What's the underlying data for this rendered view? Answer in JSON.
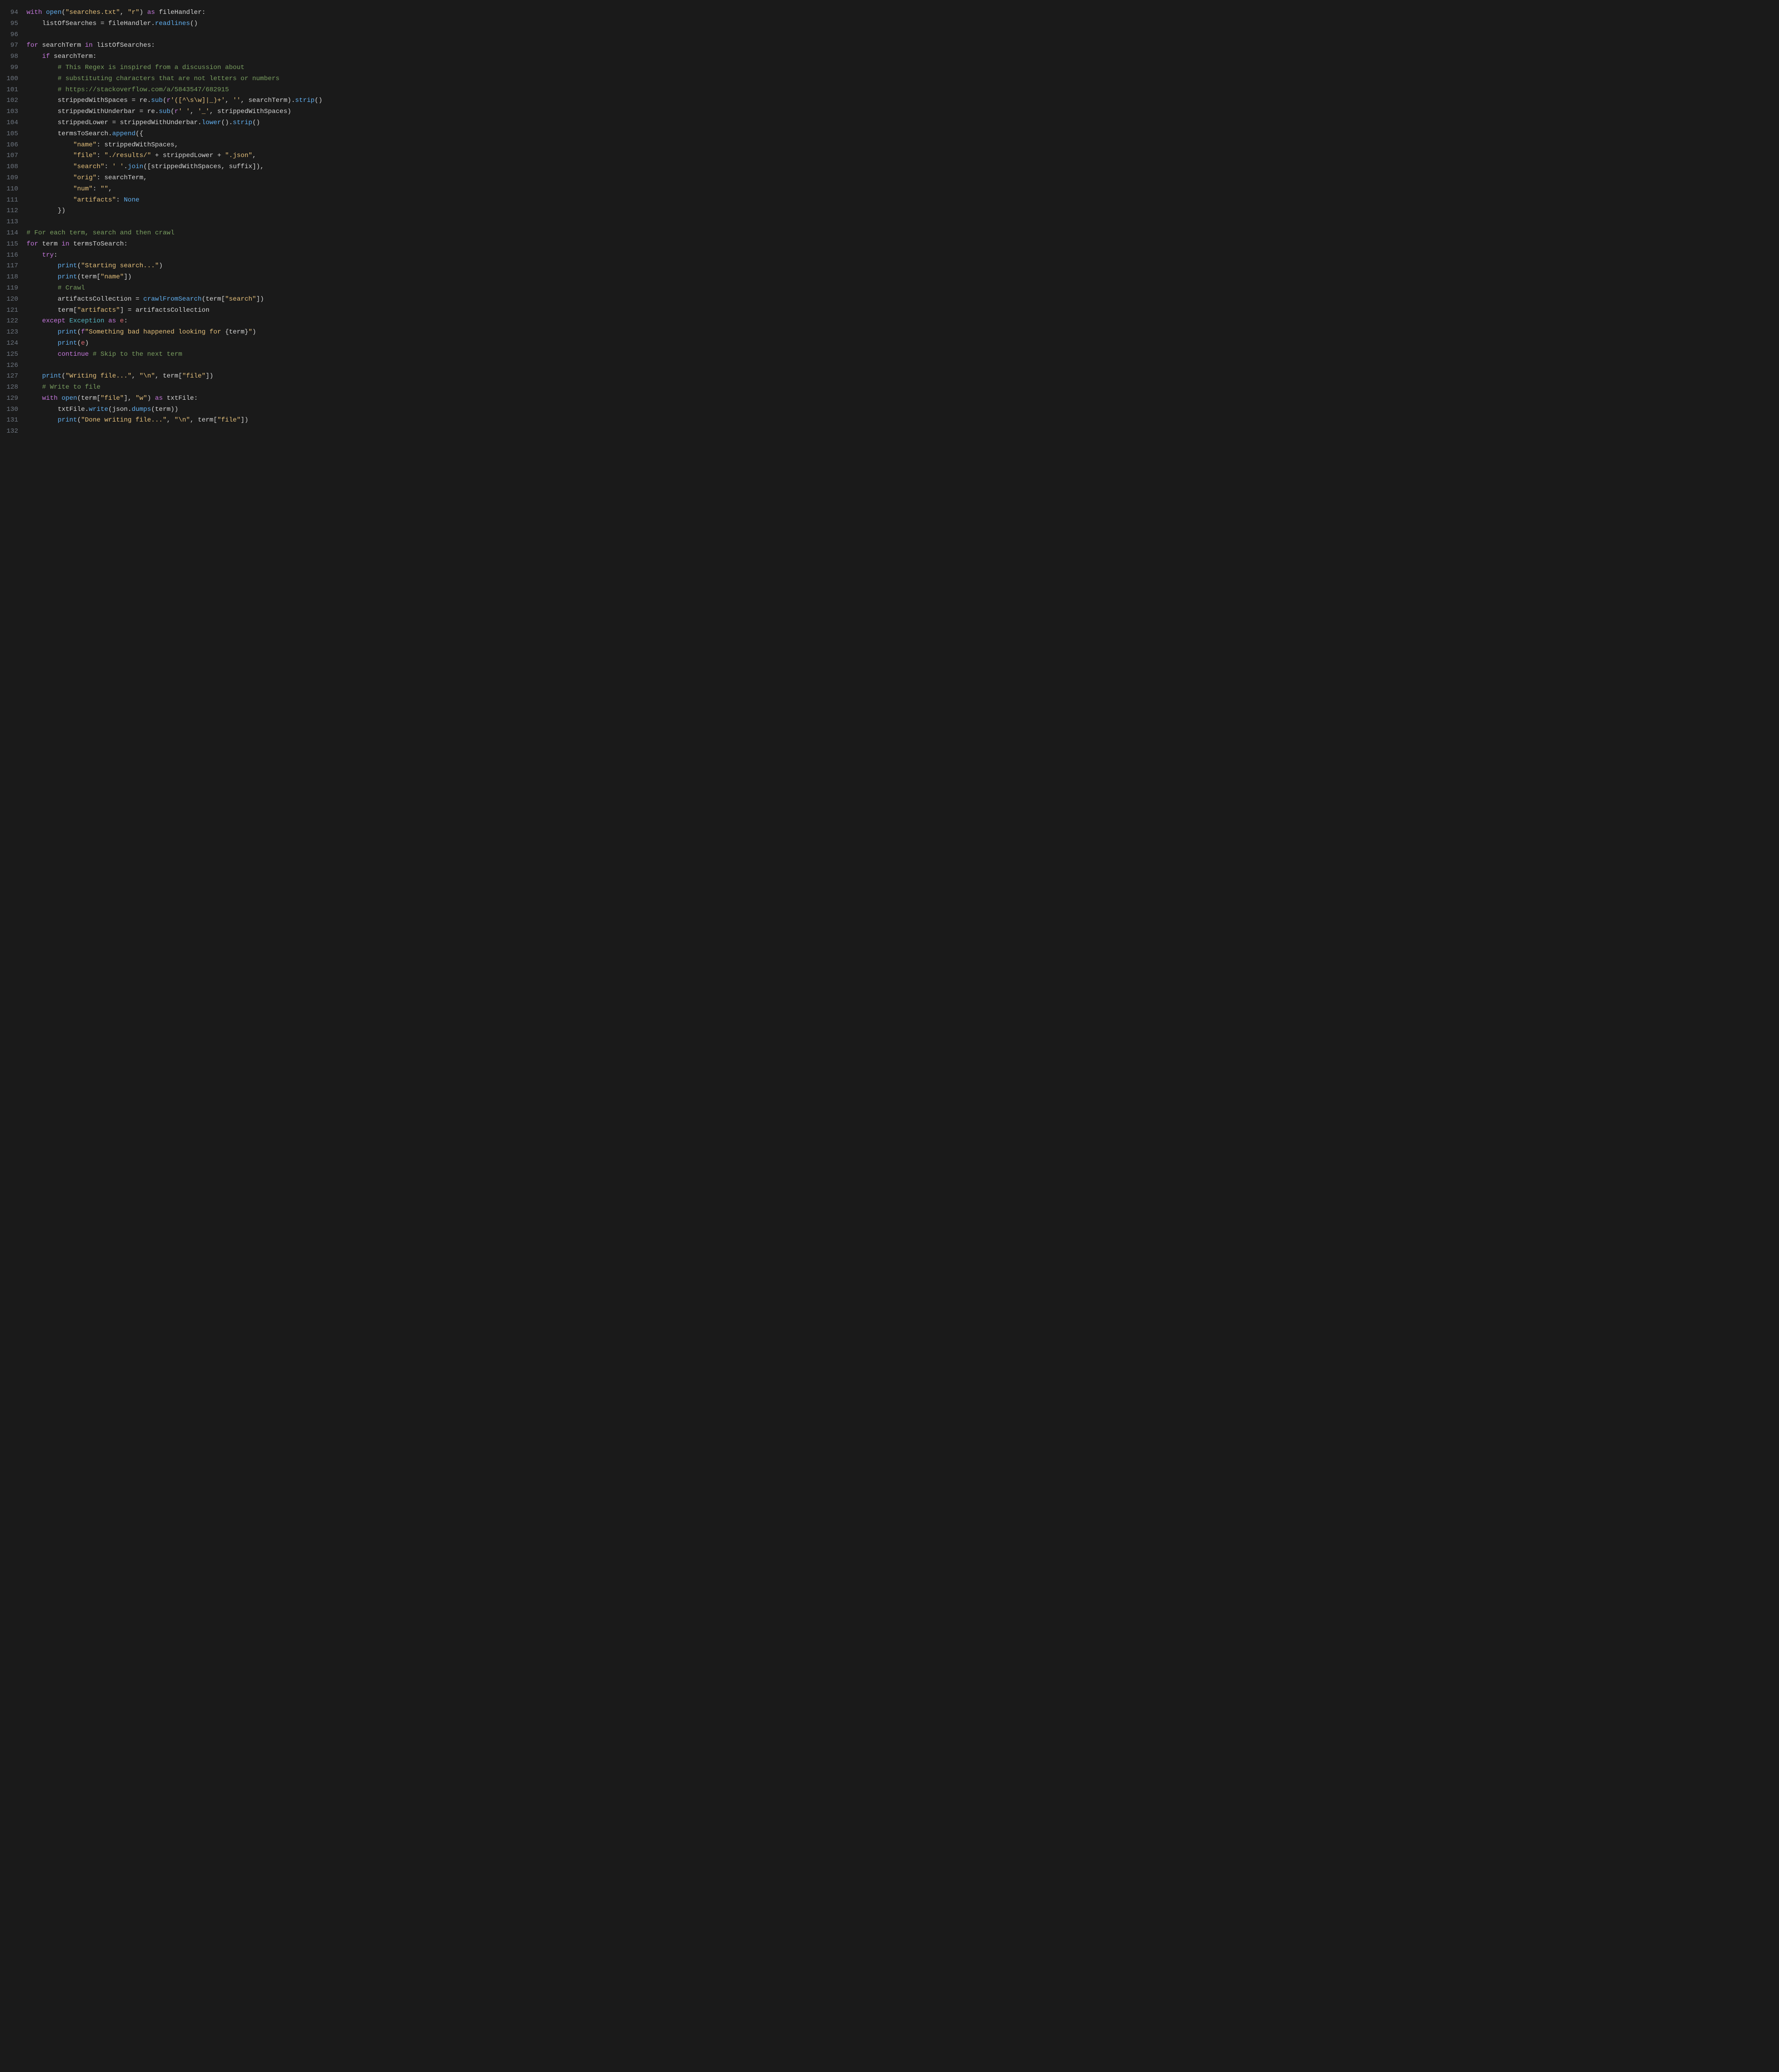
{
  "editor": {
    "startLine": 94,
    "lines": [
      {
        "n": 94,
        "tokens": [
          [
            "kw",
            "with"
          ],
          [
            "sp",
            " "
          ],
          [
            "fn",
            "open"
          ],
          [
            "op",
            "("
          ],
          [
            "str",
            "\"searches.txt\""
          ],
          [
            "op",
            ", "
          ],
          [
            "str",
            "\"r\""
          ],
          [
            "op",
            ") "
          ],
          [
            "kw",
            "as"
          ],
          [
            "sp",
            " "
          ],
          [
            "id",
            "fileHandler"
          ],
          [
            "op",
            ":"
          ]
        ]
      },
      {
        "n": 95,
        "tokens": [
          [
            "sp",
            "    "
          ],
          [
            "id",
            "listOfSearches"
          ],
          [
            "op",
            " = "
          ],
          [
            "id",
            "fileHandler"
          ],
          [
            "op",
            "."
          ],
          [
            "fn",
            "readlines"
          ],
          [
            "op",
            "()"
          ]
        ]
      },
      {
        "n": 96,
        "tokens": []
      },
      {
        "n": 97,
        "tokens": [
          [
            "kw",
            "for"
          ],
          [
            "sp",
            " "
          ],
          [
            "id",
            "searchTerm"
          ],
          [
            "sp",
            " "
          ],
          [
            "kw",
            "in"
          ],
          [
            "sp",
            " "
          ],
          [
            "id",
            "listOfSearches"
          ],
          [
            "op",
            ":"
          ]
        ]
      },
      {
        "n": 98,
        "tokens": [
          [
            "sp",
            "    "
          ],
          [
            "kw",
            "if"
          ],
          [
            "sp",
            " "
          ],
          [
            "id",
            "searchTerm"
          ],
          [
            "op",
            ":"
          ]
        ]
      },
      {
        "n": 99,
        "tokens": [
          [
            "sp",
            "        "
          ],
          [
            "comment",
            "# This Regex is inspired from a discussion about"
          ]
        ]
      },
      {
        "n": 100,
        "tokens": [
          [
            "sp",
            "        "
          ],
          [
            "comment",
            "# substituting characters that are not letters or numbers"
          ]
        ]
      },
      {
        "n": 101,
        "tokens": [
          [
            "sp",
            "        "
          ],
          [
            "comment",
            "# https://stackoverflow.com/a/5843547/682915"
          ]
        ]
      },
      {
        "n": 102,
        "tokens": [
          [
            "sp",
            "        "
          ],
          [
            "id",
            "strippedWithSpaces"
          ],
          [
            "op",
            " = "
          ],
          [
            "id",
            "re"
          ],
          [
            "op",
            "."
          ],
          [
            "fn",
            "sub"
          ],
          [
            "op",
            "("
          ],
          [
            "strprefix",
            "r"
          ],
          [
            "str",
            "'([^\\s\\w]|_)+'"
          ],
          [
            "op",
            ", "
          ],
          [
            "str",
            "''"
          ],
          [
            "op",
            ", "
          ],
          [
            "id",
            "searchTerm"
          ],
          [
            "op",
            ")."
          ],
          [
            "fn",
            "strip"
          ],
          [
            "op",
            "()"
          ]
        ]
      },
      {
        "n": 103,
        "tokens": [
          [
            "sp",
            "        "
          ],
          [
            "id",
            "strippedWithUnderbar"
          ],
          [
            "op",
            " = "
          ],
          [
            "id",
            "re"
          ],
          [
            "op",
            "."
          ],
          [
            "fn",
            "sub"
          ],
          [
            "op",
            "("
          ],
          [
            "strprefix",
            "r"
          ],
          [
            "str",
            "' '"
          ],
          [
            "op",
            ", "
          ],
          [
            "str",
            "'_'"
          ],
          [
            "op",
            ", "
          ],
          [
            "id",
            "strippedWithSpaces"
          ],
          [
            "op",
            ")"
          ]
        ]
      },
      {
        "n": 104,
        "tokens": [
          [
            "sp",
            "        "
          ],
          [
            "id",
            "strippedLower"
          ],
          [
            "op",
            " = "
          ],
          [
            "id",
            "strippedWithUnderbar"
          ],
          [
            "op",
            "."
          ],
          [
            "fn",
            "lower"
          ],
          [
            "op",
            "()."
          ],
          [
            "fn",
            "strip"
          ],
          [
            "op",
            "()"
          ]
        ]
      },
      {
        "n": 105,
        "tokens": [
          [
            "sp",
            "        "
          ],
          [
            "id",
            "termsToSearch"
          ],
          [
            "op",
            "."
          ],
          [
            "fn",
            "append"
          ],
          [
            "op",
            "({"
          ]
        ]
      },
      {
        "n": 106,
        "tokens": [
          [
            "sp",
            "            "
          ],
          [
            "str",
            "\"name\""
          ],
          [
            "op",
            ": "
          ],
          [
            "id",
            "strippedWithSpaces"
          ],
          [
            "op",
            ","
          ]
        ]
      },
      {
        "n": 107,
        "tokens": [
          [
            "sp",
            "            "
          ],
          [
            "str",
            "\"file\""
          ],
          [
            "op",
            ": "
          ],
          [
            "str",
            "\"./results/\""
          ],
          [
            "op",
            " + "
          ],
          [
            "id",
            "strippedLower"
          ],
          [
            "op",
            " + "
          ],
          [
            "str",
            "\".json\""
          ],
          [
            "op",
            ","
          ]
        ]
      },
      {
        "n": 108,
        "tokens": [
          [
            "sp",
            "            "
          ],
          [
            "str",
            "\"search\""
          ],
          [
            "op",
            ": "
          ],
          [
            "str",
            "' '"
          ],
          [
            "op",
            "."
          ],
          [
            "fn",
            "join"
          ],
          [
            "op",
            "(["
          ],
          [
            "id",
            "strippedWithSpaces"
          ],
          [
            "op",
            ", "
          ],
          [
            "id",
            "suffix"
          ],
          [
            "op",
            "]),"
          ]
        ]
      },
      {
        "n": 109,
        "tokens": [
          [
            "sp",
            "            "
          ],
          [
            "str",
            "\"orig\""
          ],
          [
            "op",
            ": "
          ],
          [
            "id",
            "searchTerm"
          ],
          [
            "op",
            ","
          ]
        ]
      },
      {
        "n": 110,
        "tokens": [
          [
            "sp",
            "            "
          ],
          [
            "str",
            "\"num\""
          ],
          [
            "op",
            ": "
          ],
          [
            "str",
            "\"\""
          ],
          [
            "op",
            ","
          ]
        ]
      },
      {
        "n": 111,
        "tokens": [
          [
            "sp",
            "            "
          ],
          [
            "str",
            "\"artifacts\""
          ],
          [
            "op",
            ": "
          ],
          [
            "const",
            "None"
          ]
        ]
      },
      {
        "n": 112,
        "tokens": [
          [
            "sp",
            "        "
          ],
          [
            "op",
            "})"
          ]
        ]
      },
      {
        "n": 113,
        "tokens": []
      },
      {
        "n": 114,
        "tokens": [
          [
            "comment",
            "# For each term, search and then crawl"
          ]
        ]
      },
      {
        "n": 115,
        "tokens": [
          [
            "kw",
            "for"
          ],
          [
            "sp",
            " "
          ],
          [
            "id",
            "term"
          ],
          [
            "sp",
            " "
          ],
          [
            "kw",
            "in"
          ],
          [
            "sp",
            " "
          ],
          [
            "id",
            "termsToSearch"
          ],
          [
            "op",
            ":"
          ]
        ]
      },
      {
        "n": 116,
        "tokens": [
          [
            "sp",
            "    "
          ],
          [
            "kw",
            "try"
          ],
          [
            "op",
            ":"
          ]
        ]
      },
      {
        "n": 117,
        "tokens": [
          [
            "sp",
            "        "
          ],
          [
            "fn",
            "print"
          ],
          [
            "op",
            "("
          ],
          [
            "str",
            "\"Starting search...\""
          ],
          [
            "op",
            ")"
          ]
        ]
      },
      {
        "n": 118,
        "tokens": [
          [
            "sp",
            "        "
          ],
          [
            "fn",
            "print"
          ],
          [
            "op",
            "("
          ],
          [
            "id",
            "term"
          ],
          [
            "op",
            "["
          ],
          [
            "str",
            "\"name\""
          ],
          [
            "op",
            "])"
          ]
        ]
      },
      {
        "n": 119,
        "tokens": [
          [
            "sp",
            "        "
          ],
          [
            "comment",
            "# Crawl"
          ]
        ]
      },
      {
        "n": 120,
        "tokens": [
          [
            "sp",
            "        "
          ],
          [
            "id",
            "artifactsCollection"
          ],
          [
            "op",
            " = "
          ],
          [
            "fn",
            "crawlFromSearch"
          ],
          [
            "op",
            "("
          ],
          [
            "id",
            "term"
          ],
          [
            "op",
            "["
          ],
          [
            "str",
            "\"search\""
          ],
          [
            "op",
            "])"
          ]
        ]
      },
      {
        "n": 121,
        "tokens": [
          [
            "sp",
            "        "
          ],
          [
            "id",
            "term"
          ],
          [
            "op",
            "["
          ],
          [
            "str",
            "\"artifacts\""
          ],
          [
            "op",
            "] = "
          ],
          [
            "id",
            "artifactsCollection"
          ]
        ]
      },
      {
        "n": 122,
        "tokens": [
          [
            "sp",
            "    "
          ],
          [
            "kw",
            "except"
          ],
          [
            "sp",
            " "
          ],
          [
            "cls",
            "Exception"
          ],
          [
            "sp",
            " "
          ],
          [
            "kw",
            "as"
          ],
          [
            "sp",
            " "
          ],
          [
            "param",
            "e"
          ],
          [
            "op",
            ":"
          ]
        ]
      },
      {
        "n": 123,
        "tokens": [
          [
            "sp",
            "        "
          ],
          [
            "fn",
            "print"
          ],
          [
            "op",
            "("
          ],
          [
            "strprefix",
            "f"
          ],
          [
            "str",
            "\"Something bad happened looking for "
          ],
          [
            "op",
            "{"
          ],
          [
            "id",
            "term"
          ],
          [
            "op",
            "}"
          ],
          [
            "str",
            "\""
          ],
          [
            "op",
            ")"
          ]
        ]
      },
      {
        "n": 124,
        "tokens": [
          [
            "sp",
            "        "
          ],
          [
            "fn",
            "print"
          ],
          [
            "op",
            "("
          ],
          [
            "param",
            "e"
          ],
          [
            "op",
            ")"
          ]
        ]
      },
      {
        "n": 125,
        "tokens": [
          [
            "sp",
            "        "
          ],
          [
            "kw",
            "continue"
          ],
          [
            "sp",
            " "
          ],
          [
            "comment",
            "# Skip to the next term"
          ]
        ]
      },
      {
        "n": 126,
        "tokens": []
      },
      {
        "n": 127,
        "tokens": [
          [
            "sp",
            "    "
          ],
          [
            "fn",
            "print"
          ],
          [
            "op",
            "("
          ],
          [
            "str",
            "\"Writing file...\""
          ],
          [
            "op",
            ", "
          ],
          [
            "str",
            "\"\\n\""
          ],
          [
            "op",
            ", "
          ],
          [
            "id",
            "term"
          ],
          [
            "op",
            "["
          ],
          [
            "str",
            "\"file\""
          ],
          [
            "op",
            "])"
          ]
        ]
      },
      {
        "n": 128,
        "tokens": [
          [
            "sp",
            "    "
          ],
          [
            "comment",
            "# Write to file"
          ]
        ]
      },
      {
        "n": 129,
        "tokens": [
          [
            "sp",
            "    "
          ],
          [
            "kw",
            "with"
          ],
          [
            "sp",
            " "
          ],
          [
            "fn",
            "open"
          ],
          [
            "op",
            "("
          ],
          [
            "id",
            "term"
          ],
          [
            "op",
            "["
          ],
          [
            "str",
            "\"file\""
          ],
          [
            "op",
            "], "
          ],
          [
            "str",
            "\"w\""
          ],
          [
            "op",
            ") "
          ],
          [
            "kw",
            "as"
          ],
          [
            "sp",
            " "
          ],
          [
            "id",
            "txtFile"
          ],
          [
            "op",
            ":"
          ]
        ]
      },
      {
        "n": 130,
        "tokens": [
          [
            "sp",
            "        "
          ],
          [
            "id",
            "txtFile"
          ],
          [
            "op",
            "."
          ],
          [
            "fn",
            "write"
          ],
          [
            "op",
            "("
          ],
          [
            "id",
            "json"
          ],
          [
            "op",
            "."
          ],
          [
            "fn",
            "dumps"
          ],
          [
            "op",
            "("
          ],
          [
            "id",
            "term"
          ],
          [
            "op",
            "))"
          ]
        ]
      },
      {
        "n": 131,
        "tokens": [
          [
            "sp",
            "        "
          ],
          [
            "fn",
            "print"
          ],
          [
            "op",
            "("
          ],
          [
            "str",
            "\"Done writing file...\""
          ],
          [
            "op",
            ", "
          ],
          [
            "str",
            "\"\\n\""
          ],
          [
            "op",
            ", "
          ],
          [
            "id",
            "term"
          ],
          [
            "op",
            "["
          ],
          [
            "str",
            "\"file\""
          ],
          [
            "op",
            "])"
          ]
        ]
      },
      {
        "n": 132,
        "tokens": []
      }
    ]
  }
}
